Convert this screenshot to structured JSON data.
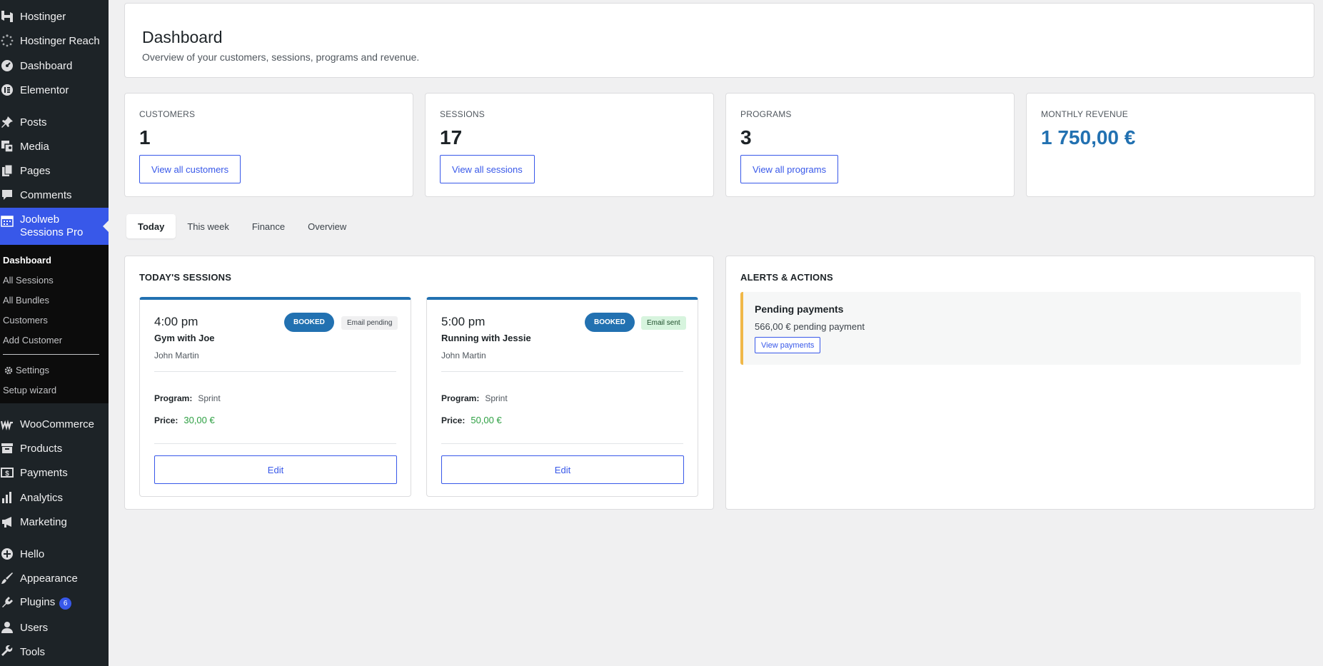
{
  "sidebar": {
    "items": [
      {
        "label": "Hostinger",
        "icon": "hostinger-icon"
      },
      {
        "label": "Hostinger Reach",
        "icon": "reach-icon"
      },
      {
        "label": "Dashboard",
        "icon": "dashboard-icon"
      },
      {
        "label": "Elementor",
        "icon": "elementor-icon"
      },
      {
        "label": "Posts",
        "icon": "pin-icon"
      },
      {
        "label": "Media",
        "icon": "media-icon"
      },
      {
        "label": "Pages",
        "icon": "pages-icon"
      },
      {
        "label": "Comments",
        "icon": "comment-icon"
      },
      {
        "label": "Joolweb Sessions Pro",
        "icon": "calendar-icon"
      },
      {
        "label": "WooCommerce",
        "icon": "woocommerce-icon"
      },
      {
        "label": "Products",
        "icon": "archive-icon"
      },
      {
        "label": "Payments",
        "icon": "dollar-icon"
      },
      {
        "label": "Analytics",
        "icon": "bar-chart-icon"
      },
      {
        "label": "Marketing",
        "icon": "megaphone-icon"
      },
      {
        "label": "Hello",
        "icon": "plus-circle-icon"
      },
      {
        "label": "Appearance",
        "icon": "brush-icon"
      },
      {
        "label": "Plugins",
        "icon": "plug-icon",
        "badge": "6"
      },
      {
        "label": "Users",
        "icon": "user-icon"
      },
      {
        "label": "Tools",
        "icon": "wrench-icon"
      }
    ],
    "submenu": [
      {
        "label": "Dashboard"
      },
      {
        "label": "All Sessions"
      },
      {
        "label": "All Bundles"
      },
      {
        "label": "Customers"
      },
      {
        "label": "Add Customer"
      },
      {
        "label": "Settings",
        "icon": "gear-icon"
      },
      {
        "label": "Setup wizard"
      }
    ]
  },
  "header": {
    "title": "Dashboard",
    "subtitle": "Overview of your customers, sessions, programs and revenue."
  },
  "stats": [
    {
      "label": "CUSTOMERS",
      "value": "1",
      "button": "View all customers"
    },
    {
      "label": "SESSIONS",
      "value": "17",
      "button": "View all sessions"
    },
    {
      "label": "PROGRAMS",
      "value": "3",
      "button": "View all programs"
    },
    {
      "label": "MONTHLY REVENUE",
      "value": "1 750,00 €"
    }
  ],
  "tabs": [
    "Today",
    "This week",
    "Finance",
    "Overview"
  ],
  "sessions_panel": {
    "title": "TODAY'S SESSIONS",
    "program_label": "Program:",
    "price_label": "Price:",
    "edit_label": "Edit",
    "sessions": [
      {
        "time": "4:00 pm",
        "name": "Gym with Joe",
        "customer": "John Martin",
        "status": "BOOKED",
        "email": "Email pending",
        "program": "Sprint",
        "price": "30,00 €"
      },
      {
        "time": "5:00 pm",
        "name": "Running with Jessie",
        "customer": "John Martin",
        "status": "BOOKED",
        "email": "Email sent",
        "program": "Sprint",
        "price": "50,00 €"
      }
    ]
  },
  "alerts_panel": {
    "title": "ALERTS & ACTIONS",
    "alert_title": "Pending payments",
    "alert_text": "566,00 € pending payment",
    "alert_button": "View payments"
  },
  "colors": {
    "sidebar_bg": "#1d2327",
    "accent": "#3858e9",
    "booked": "#2271b1",
    "price_green": "#2ea043",
    "alert_border": "#f0b849"
  }
}
